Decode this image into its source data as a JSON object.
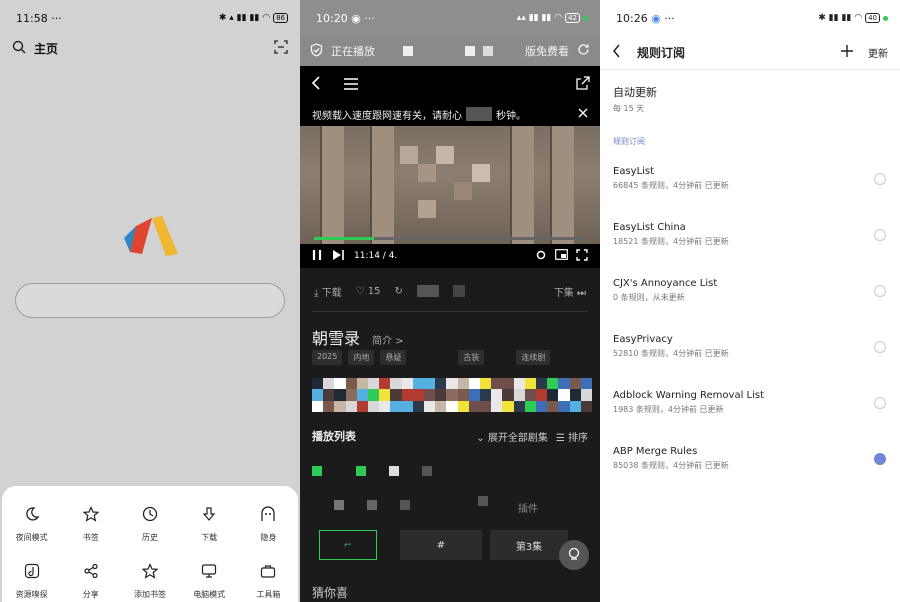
{
  "panel1": {
    "status": {
      "time": "11:58",
      "dots": "···",
      "battery": "86"
    },
    "topbar": {
      "label": "主页"
    },
    "sheet_items": [
      {
        "label": "夜间模式",
        "icon": "moon-icon"
      },
      {
        "label": "书签",
        "icon": "star-icon"
      },
      {
        "label": "历史",
        "icon": "clock-icon"
      },
      {
        "label": "下载",
        "icon": "download-icon"
      },
      {
        "label": "隐身",
        "icon": "ghost-icon"
      },
      {
        "label": "资源嗅探",
        "icon": "music-note-icon"
      },
      {
        "label": "分享",
        "icon": "share-icon"
      },
      {
        "label": "添加书签",
        "icon": "star-plus-icon"
      },
      {
        "label": "电脑模式",
        "icon": "monitor-icon"
      },
      {
        "label": "工具箱",
        "icon": "toolbox-icon"
      }
    ]
  },
  "panel2": {
    "status": {
      "time": "10:20",
      "battery": "42"
    },
    "header": {
      "left": "正在播放",
      "right": "版免费看"
    },
    "notice": "视频载入速度跟网速有关，请耐心",
    "notice_end": "秒钟。",
    "time_display": "11:14 / 4.",
    "actions": {
      "download": "下载",
      "likes": "15",
      "next": "下集"
    },
    "title": "朝雪录",
    "intro": "简介 >",
    "tags": [
      "2025",
      "内地",
      "悬疑",
      "古装",
      "连续剧"
    ],
    "playlist": {
      "title": "播放列表",
      "expand": "展开全部剧集",
      "sort": "排序"
    },
    "extra_label": "插件",
    "episode_label": "第3集",
    "bottom_text": "猜你喜"
  },
  "panel3": {
    "status": {
      "time": "10:26",
      "battery": "40"
    },
    "header": {
      "title": "规则订阅",
      "update": "更新"
    },
    "auto_update": {
      "title": "自动更新",
      "value": "每 15 天"
    },
    "section": "规则订阅",
    "rules": [
      {
        "name": "EasyList",
        "desc": "66845 条规则，4分钟前 已更新",
        "selected": false
      },
      {
        "name": "EasyList China",
        "desc": "18521 条规则，4分钟前 已更新",
        "selected": false
      },
      {
        "name": "CJX's Annoyance List",
        "desc": "0 条规则，从未更新",
        "selected": false
      },
      {
        "name": "EasyPrivacy",
        "desc": "52810 条规则，4分钟前 已更新",
        "selected": false
      },
      {
        "name": "Adblock Warning Removal List",
        "desc": "1983 条规则，4分钟前 已更新",
        "selected": false
      },
      {
        "name": "ABP Merge Rules",
        "desc": "85038 条规则，4分钟前 已更新",
        "selected": true
      }
    ]
  },
  "colors": {
    "accent_green": "#2ecc55",
    "radio_blue": "#6f86d6",
    "section_blue": "#6f86c4"
  }
}
